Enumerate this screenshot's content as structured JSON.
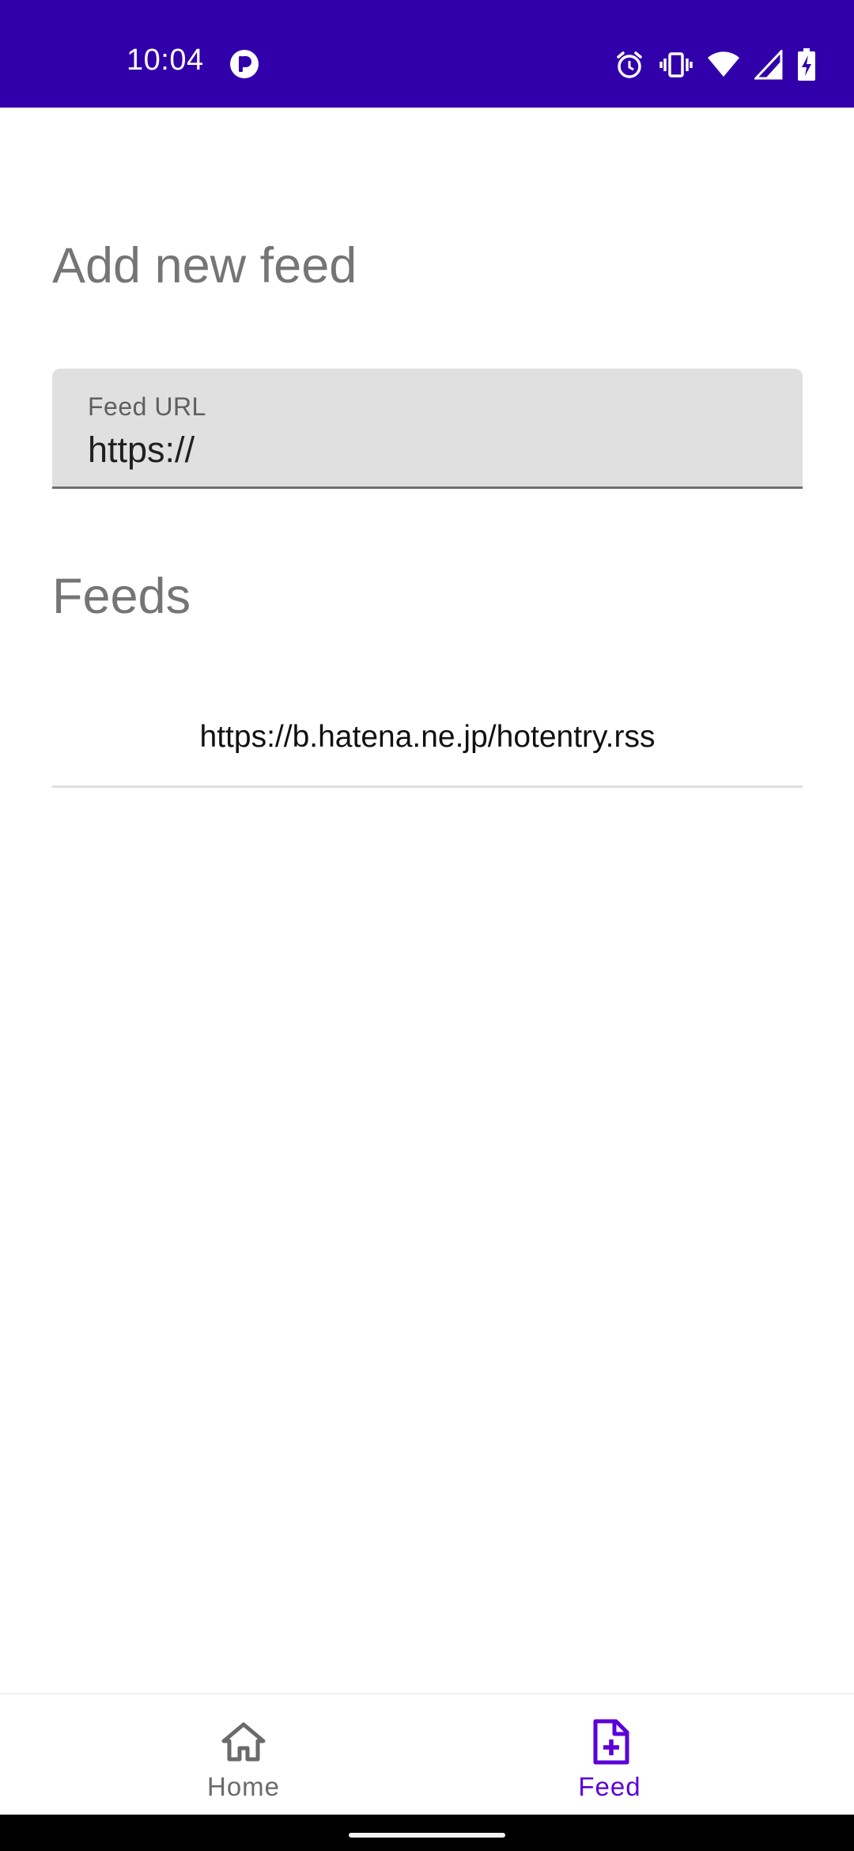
{
  "status_bar": {
    "time": "10:04",
    "icons": [
      "app-notification-icon",
      "alarm-icon",
      "vibrate-icon",
      "wifi-icon",
      "cell-signal-icon",
      "battery-charging-icon"
    ],
    "background": "#3200aa"
  },
  "add_feed": {
    "title": "Add new feed",
    "field_label": "Feed URL",
    "field_value": "https://"
  },
  "feeds": {
    "title": "Feeds",
    "items": [
      {
        "url": "https://b.hatena.ne.jp/hotentry.rss"
      }
    ]
  },
  "bottom_nav": {
    "items": [
      {
        "label": "Home",
        "icon": "home-icon",
        "active": false
      },
      {
        "label": "Feed",
        "icon": "note-add-icon",
        "active": true
      }
    ],
    "active_color": "#5b00d8",
    "inactive_color": "#6a6a6a"
  }
}
